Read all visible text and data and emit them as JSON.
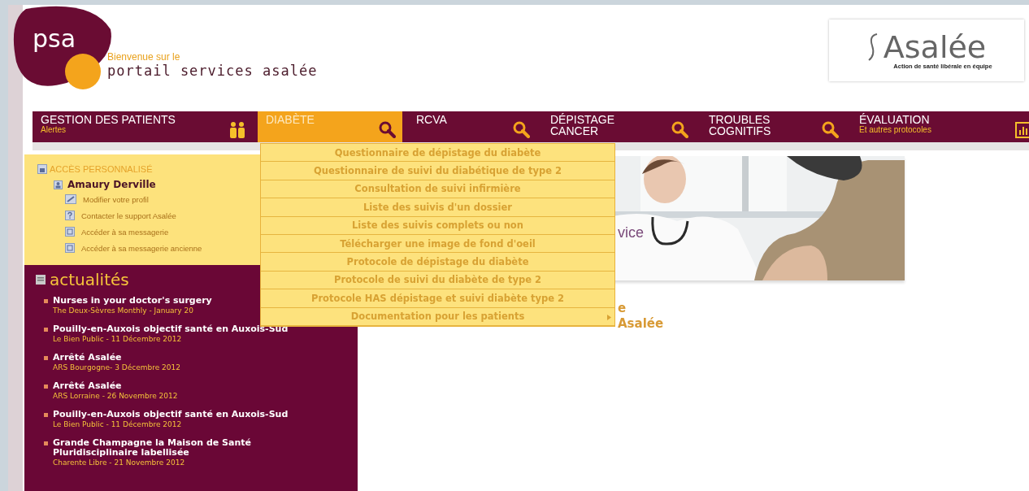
{
  "header": {
    "logo_text": "psa",
    "welcome": "Bienvenue sur le",
    "portal_name": "portail services asalée",
    "partner_name": "Asalée",
    "partner_tagline": "Action de santé libérale en équipe"
  },
  "nav": [
    {
      "label": "GESTION DES PATIENTS",
      "sublabel": "Alertes",
      "selected": false
    },
    {
      "label": "DIABÈTE",
      "selected": true
    },
    {
      "label": "RCVA",
      "selected": false
    },
    {
      "label": "DÉPISTAGE\nCANCER",
      "selected": false
    },
    {
      "label": "TROUBLES\nCOGNITIFS",
      "selected": false
    },
    {
      "label": "ÉVALUATION",
      "sublabel": "Et autres protocoles",
      "selected": false
    }
  ],
  "dropdown": [
    {
      "label": "Questionnaire de dépistage du diabète",
      "has_submenu": false
    },
    {
      "label": "Questionnaire de suivi du diabétique de type 2",
      "has_submenu": false
    },
    {
      "label": "Consultation de suivi infirmière",
      "has_submenu": false
    },
    {
      "label": "Liste des suivis d'un dossier",
      "has_submenu": false
    },
    {
      "label": "Liste des suivis complets ou non",
      "has_submenu": false
    },
    {
      "label": "Télécharger une image de fond d'oeil",
      "has_submenu": false
    },
    {
      "label": "Protocole de dépistage du diabète",
      "has_submenu": false
    },
    {
      "label": "Protocole de suivi du diabète de type 2",
      "has_submenu": false
    },
    {
      "label": "Protocole HAS dépistage et suivi diabète type 2",
      "has_submenu": false
    },
    {
      "label": "Documentation pour les patients",
      "has_submenu": true
    }
  ],
  "access": {
    "title": "ACCÈS PERSONNALISÉ",
    "user": "Amaury Derville",
    "links": [
      {
        "label": "Modifier votre profil"
      },
      {
        "label": "Contacter le support Asalée"
      },
      {
        "label": "Accéder à sa messagerie"
      },
      {
        "label": "Accéder à sa messagerie ancienne"
      }
    ]
  },
  "news": {
    "title": "actualités",
    "items": [
      {
        "title": "Nurses in your doctor's surgery",
        "source": "The Deux-Sèvres Monthly - January 20"
      },
      {
        "title": "Pouilly-en-Auxois objectif santé en Auxois-Sud",
        "source": "Le Bien Public - 11 Décembre 2012"
      },
      {
        "title": "Arrêté Asalée",
        "source": "ARS Bourgogne- 3 Décembre 2012"
      },
      {
        "title": "Arrêté Asalée",
        "source": "ARS Lorraine - 26 Novembre 2012"
      },
      {
        "title": "Pouilly-en-Auxois objectif santé en Auxois-Sud",
        "source": "Le Bien Public - 11 Décembre 2012"
      },
      {
        "title": "Grande Champagne la Maison de Santé Pluridisciplinaire labellisée",
        "source": "Charente Libre - 21 Novembre 2012"
      }
    ]
  },
  "main": {
    "banner_caption": "vice",
    "heading": [
      "e",
      "Asalée"
    ]
  }
}
